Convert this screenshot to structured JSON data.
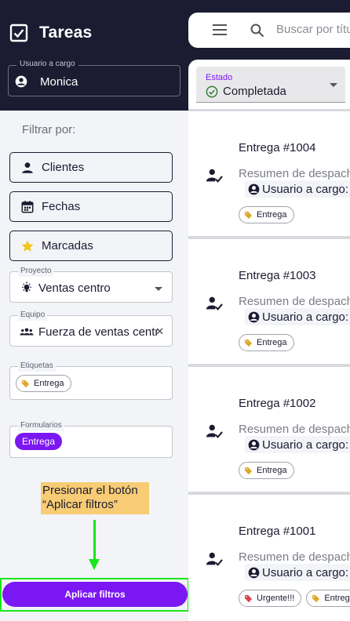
{
  "app": {
    "title": "Tareas",
    "icon": "checkbox-icon"
  },
  "user_field": {
    "label": "Usuario a cargo",
    "value": "Monica",
    "icon": "account-circle-icon"
  },
  "filters": {
    "heading": "Filtrar por:",
    "buttons": [
      {
        "label": "Clientes",
        "icon": "person-icon"
      },
      {
        "label": "Fechas",
        "icon": "calendar-icon"
      },
      {
        "label": "Marcadas",
        "icon": "star-icon"
      }
    ],
    "project": {
      "label": "Proyecto",
      "value": "Ventas centro",
      "icon": "lightbulb-icon"
    },
    "team": {
      "label": "Equipo",
      "value": "Fuerza de ventas centro",
      "icon": "group-icon"
    },
    "tags": {
      "label": "Etiquetas",
      "chips": [
        "Entrega"
      ]
    },
    "forms": {
      "label": "Formularios",
      "chips": [
        "Entrega"
      ]
    }
  },
  "annotation": {
    "line1": "Presionar el botón",
    "line2": "“Aplicar filtros”"
  },
  "apply_button": {
    "label": "Aplicar filtros"
  },
  "search": {
    "placeholder": "Buscar por título"
  },
  "state_filter": {
    "label": "Estado",
    "value": "Completada",
    "icon": "check-circle-icon"
  },
  "cards": [
    {
      "title": "Entrega #1004",
      "summary": "Resumen de despacho",
      "user": "Usuario a cargo: R",
      "tags": [
        "Entrega"
      ]
    },
    {
      "title": "Entrega #1003",
      "summary": "Resumen de despacho",
      "user": "Usuario a cargo: M",
      "tags": [
        "Entrega"
      ]
    },
    {
      "title": "Entrega #1002",
      "summary": "Resumen de despacho",
      "user": "Usuario a cargo: M",
      "tags": [
        "Entrega"
      ]
    },
    {
      "title": "Entrega #1001",
      "summary": "Resumen de despacho",
      "user": "Usuario a cargo: M",
      "tags": [
        "Urgente!!!",
        "Entrega"
      ]
    }
  ],
  "colors": {
    "dark": "#1b1b31",
    "accent": "#7b17f2",
    "highlight": "#19e61c",
    "note": "#f7cc74",
    "tag_entrega": "#e0a72a",
    "tag_urgente": "#d9434a",
    "check_green": "#2e7d32"
  }
}
